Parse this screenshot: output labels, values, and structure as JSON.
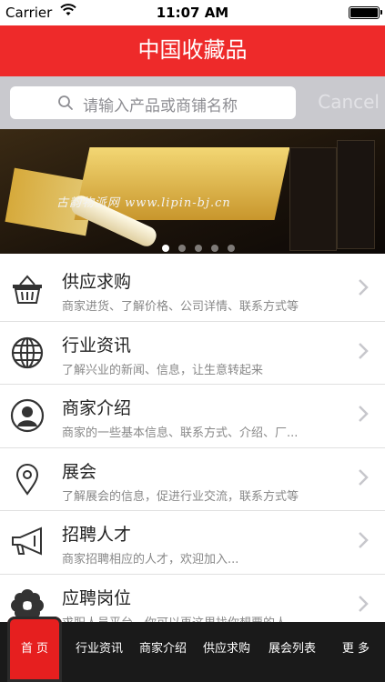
{
  "status": {
    "carrier": "Carrier",
    "time": "11:07 AM"
  },
  "nav": {
    "title": "中国收藏品"
  },
  "search": {
    "placeholder": "请输入产品或商铺名称",
    "cancel": "Cancel"
  },
  "banner": {
    "watermark": "古韵物派网  www.lipin-bj.cn",
    "page_count": 5,
    "active_page": 1
  },
  "list": [
    {
      "icon": "basket-icon",
      "title": "供应求购",
      "subtitle": "商家进货、了解价格、公司详情、联系方式等"
    },
    {
      "icon": "globe-icon",
      "title": "行业资讯",
      "subtitle": "了解兴业的新闻、信息，让生意转起来"
    },
    {
      "icon": "person-icon",
      "title": "商家介绍",
      "subtitle": "商家的一些基本信息、联系方式、介绍、厂..."
    },
    {
      "icon": "location-pin-icon",
      "title": "展会",
      "subtitle": "了解展会的信息，促进行业交流，联系方式等"
    },
    {
      "icon": "megaphone-icon",
      "title": "招聘人才",
      "subtitle": "商家招聘相应的人才，欢迎加入..."
    },
    {
      "icon": "flower-icon",
      "title": "应聘岗位",
      "subtitle": "求职人员平台，你可以再这里找你想要的人..."
    }
  ],
  "tabs": [
    {
      "label": "首  页",
      "active": true
    },
    {
      "label": "行业资讯"
    },
    {
      "label": "商家介绍"
    },
    {
      "label": "供应求购"
    },
    {
      "label": "展会列表"
    },
    {
      "label": "更  多"
    }
  ],
  "colors": {
    "accent": "#ee2a2a",
    "tabbar": "#1a1a1a",
    "search_bg": "#c9c9ce"
  }
}
